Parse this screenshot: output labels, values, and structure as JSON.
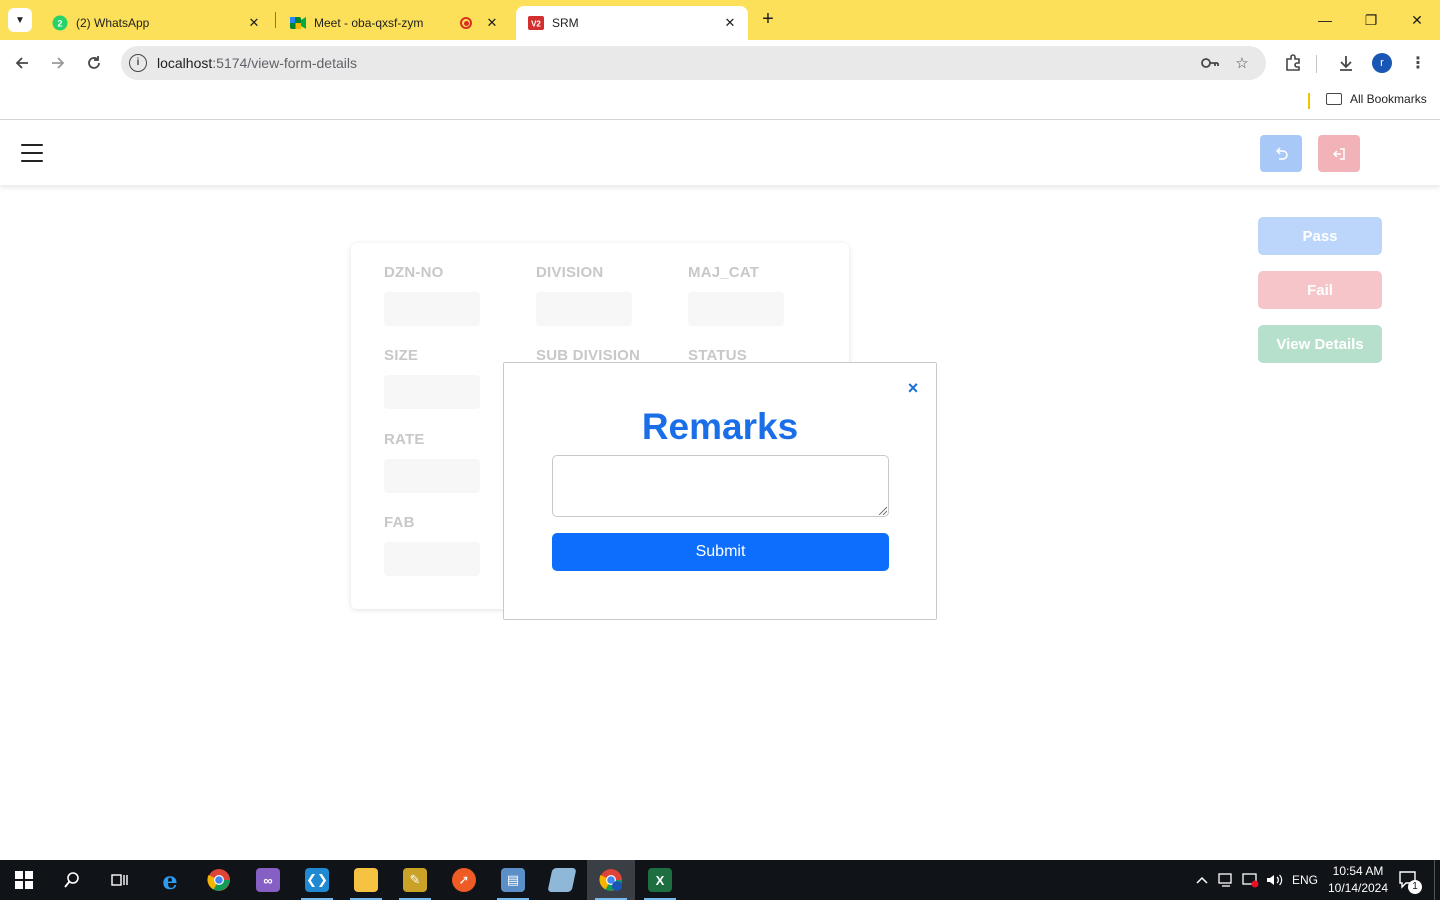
{
  "browser": {
    "tabs": [
      {
        "title": "(2) WhatsApp",
        "badge": "2",
        "active": false
      },
      {
        "title": "Meet - oba-qxsf-zym",
        "recording": true,
        "active": false
      },
      {
        "title": "SRM",
        "favicon_text": "V2",
        "active": true
      }
    ],
    "url_host": "localhost",
    "url_path": ":5174/view-form-details",
    "profile_initial": "r",
    "bookmarks_label": "All Bookmarks"
  },
  "form": {
    "fields": [
      {
        "label": "DZN-NO"
      },
      {
        "label": "DIVISION"
      },
      {
        "label": "MAJ_CAT"
      },
      {
        "label": "SIZE"
      },
      {
        "label": "SUB DIVISION"
      },
      {
        "label": "STATUS"
      },
      {
        "label": "RATE"
      },
      {
        "label": "FAB"
      }
    ]
  },
  "actions": {
    "pass_label": "Pass",
    "fail_label": "Fail",
    "view_details_label": "View Details"
  },
  "modal": {
    "title": "Remarks",
    "textarea_value": "",
    "submit_label": "Submit",
    "close_glyph": "×"
  },
  "taskbar": {
    "language": "ENG",
    "time": "10:54 AM",
    "date": "10/14/2024",
    "notification_count": "1"
  },
  "colors": {
    "browser_frame": "#fce059",
    "primary": "#0d6efd",
    "title_blue": "#1a6fe8",
    "pass_faded": "#bcd6fb",
    "fail_faded": "#f6c5ca",
    "view_faded": "#b7e0cc"
  }
}
